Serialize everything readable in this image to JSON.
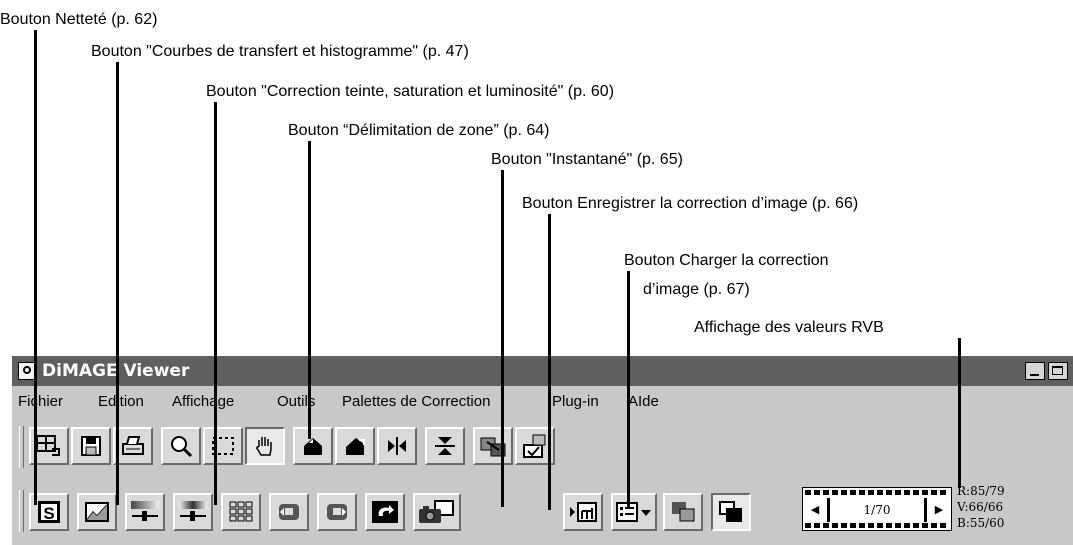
{
  "callouts": {
    "sharpness": "Bouton Netteté (p. 62)",
    "curves": "Bouton \"Courbes de transfert et histogramme\" (p. 47)",
    "hue": "Bouton \"Correction teinte, saturation et luminosité\" (p. 60)",
    "area": "Bouton “Délimitation de zone”  (p. 64)",
    "snapshot": "Bouton \"Instantané\" (p. 65)",
    "save_correction": "Bouton Enregistrer la correction d’image (p. 66)",
    "load_correction_1": "Bouton Charger la correction",
    "load_correction_2": "d’image (p. 67)",
    "rgb_display": "Affichage des valeurs RVB"
  },
  "window": {
    "title": "DiMAGE Viewer"
  },
  "menu": [
    "Fichier",
    "Edition",
    "Affichage",
    "Outils",
    "Palettes de Correction",
    "Plug-in",
    "AIde"
  ],
  "toolbar1_icons": [
    "thumbnail-view-icon",
    "save-icon",
    "print-icon",
    "zoom-icon",
    "area-select-icon",
    "hand-icon",
    "rotate-left-icon",
    "rotate-right-icon",
    "flip-horizontal-icon",
    "flip-vertical-icon",
    "export-icon",
    "acquire-icon"
  ],
  "toolbar2_icons": [
    "sharpness-icon",
    "curves-icon",
    "color-balance-icon",
    "hue-saturation-icon",
    "variations-icon",
    "undo-correction-icon",
    "redo-correction-icon",
    "reset-icon",
    "snapshot-icon",
    "save-correction-icon",
    "load-correction-icon",
    "overlay-icon",
    "compare-icon"
  ],
  "filmstrip": {
    "counter": "1/70"
  },
  "rgb": {
    "r": "R:85/79",
    "v": "V:66/66",
    "b": "B:55/60"
  }
}
